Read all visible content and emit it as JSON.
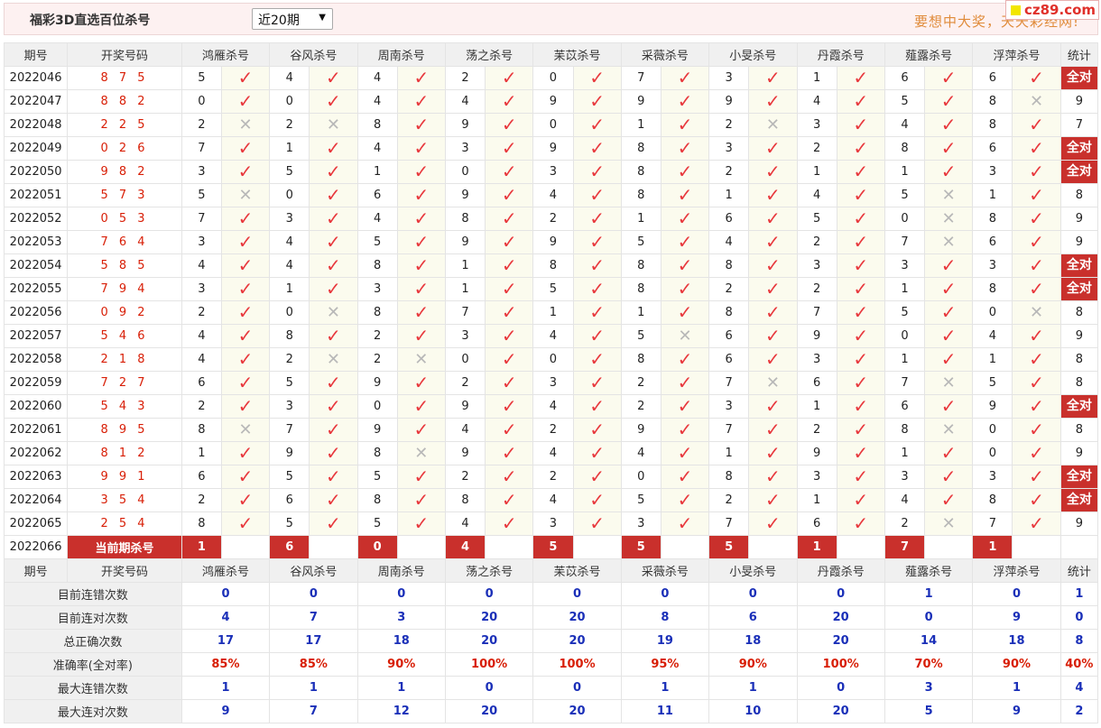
{
  "header": {
    "title": "福彩3D直选百位杀号",
    "period_select": "近20期",
    "slogan": "要想中大奖，天天彩经网!",
    "site_badge": "cz89.com"
  },
  "columns": {
    "issue": "期号",
    "draw": "开奖号码",
    "experts": [
      "鸿雁杀号",
      "谷风杀号",
      "周南杀号",
      "荡之杀号",
      "苿苡杀号",
      "采薇杀号",
      "小旻杀号",
      "丹霞杀号",
      "薤露杀号",
      "浮萍杀号"
    ],
    "stat": "统计"
  },
  "rows": [
    {
      "issue": "2022046",
      "draw": "8 7 5",
      "kills": [
        "5",
        "4",
        "4",
        "2",
        "0",
        "7",
        "3",
        "1",
        "6",
        "6"
      ],
      "marks": "1111111111",
      "stat": "全对"
    },
    {
      "issue": "2022047",
      "draw": "8 8 2",
      "kills": [
        "0",
        "0",
        "4",
        "4",
        "9",
        "9",
        "9",
        "4",
        "5",
        "8"
      ],
      "marks": "1111111110",
      "stat": "9"
    },
    {
      "issue": "2022048",
      "draw": "2 2 5",
      "kills": [
        "2",
        "2",
        "8",
        "9",
        "0",
        "1",
        "2",
        "3",
        "4",
        "8"
      ],
      "marks": "0011110111",
      "stat": "7"
    },
    {
      "issue": "2022049",
      "draw": "0 2 6",
      "kills": [
        "7",
        "1",
        "4",
        "3",
        "9",
        "8",
        "3",
        "2",
        "8",
        "6"
      ],
      "marks": "1111111111",
      "stat": "全对"
    },
    {
      "issue": "2022050",
      "draw": "9 8 2",
      "kills": [
        "3",
        "5",
        "1",
        "0",
        "3",
        "8",
        "2",
        "1",
        "1",
        "3"
      ],
      "marks": "1111111111",
      "stat": "全对"
    },
    {
      "issue": "2022051",
      "draw": "5 7 3",
      "kills": [
        "5",
        "0",
        "6",
        "9",
        "4",
        "8",
        "1",
        "4",
        "5",
        "1"
      ],
      "marks": "0111111101",
      "stat": "8"
    },
    {
      "issue": "2022052",
      "draw": "0 5 3",
      "kills": [
        "7",
        "3",
        "4",
        "8",
        "2",
        "1",
        "6",
        "5",
        "0",
        "8"
      ],
      "marks": "1111111101",
      "stat": "9"
    },
    {
      "issue": "2022053",
      "draw": "7 6 4",
      "kills": [
        "3",
        "4",
        "5",
        "9",
        "9",
        "5",
        "4",
        "2",
        "7",
        "6"
      ],
      "marks": "1111111101",
      "stat": "9"
    },
    {
      "issue": "2022054",
      "draw": "5 8 5",
      "kills": [
        "4",
        "4",
        "8",
        "1",
        "8",
        "8",
        "8",
        "3",
        "3",
        "3"
      ],
      "marks": "1111111111",
      "stat": "全对"
    },
    {
      "issue": "2022055",
      "draw": "7 9 4",
      "kills": [
        "3",
        "1",
        "3",
        "1",
        "5",
        "8",
        "2",
        "2",
        "1",
        "8"
      ],
      "marks": "1111111111",
      "stat": "全对"
    },
    {
      "issue": "2022056",
      "draw": "0 9 2",
      "kills": [
        "2",
        "0",
        "8",
        "7",
        "1",
        "1",
        "8",
        "7",
        "5",
        "0"
      ],
      "marks": "1011111110",
      "stat": "8"
    },
    {
      "issue": "2022057",
      "draw": "5 4 6",
      "kills": [
        "4",
        "8",
        "2",
        "3",
        "4",
        "5",
        "6",
        "9",
        "0",
        "4"
      ],
      "marks": "1111101111",
      "stat": "9"
    },
    {
      "issue": "2022058",
      "draw": "2 1 8",
      "kills": [
        "4",
        "2",
        "2",
        "0",
        "0",
        "8",
        "6",
        "3",
        "1",
        "1"
      ],
      "marks": "1001111111",
      "stat": "8"
    },
    {
      "issue": "2022059",
      "draw": "7 2 7",
      "kills": [
        "6",
        "5",
        "9",
        "2",
        "3",
        "2",
        "7",
        "6",
        "7",
        "5"
      ],
      "marks": "1111110101",
      "stat": "8"
    },
    {
      "issue": "2022060",
      "draw": "5 4 3",
      "kills": [
        "2",
        "3",
        "0",
        "9",
        "4",
        "2",
        "3",
        "1",
        "6",
        "9"
      ],
      "marks": "1111111111",
      "stat": "全对"
    },
    {
      "issue": "2022061",
      "draw": "8 9 5",
      "kills": [
        "8",
        "7",
        "9",
        "4",
        "2",
        "9",
        "7",
        "2",
        "8",
        "0"
      ],
      "marks": "0111111101",
      "stat": "8"
    },
    {
      "issue": "2022062",
      "draw": "8 1 2",
      "kills": [
        "1",
        "9",
        "8",
        "9",
        "4",
        "4",
        "1",
        "9",
        "1",
        "0"
      ],
      "marks": "1101111111",
      "stat": "9"
    },
    {
      "issue": "2022063",
      "draw": "9 9 1",
      "kills": [
        "6",
        "5",
        "5",
        "2",
        "2",
        "0",
        "8",
        "3",
        "3",
        "3"
      ],
      "marks": "1111111111",
      "stat": "全对"
    },
    {
      "issue": "2022064",
      "draw": "3 5 4",
      "kills": [
        "2",
        "6",
        "8",
        "8",
        "4",
        "5",
        "2",
        "1",
        "4",
        "8"
      ],
      "marks": "1111111111",
      "stat": "全对"
    },
    {
      "issue": "2022065",
      "draw": "2 5 4",
      "kills": [
        "8",
        "5",
        "5",
        "4",
        "3",
        "3",
        "7",
        "6",
        "2",
        "7"
      ],
      "marks": "1111111101",
      "stat": "9"
    }
  ],
  "current": {
    "issue": "2022066",
    "label": "当前期杀号",
    "kills": [
      "1",
      "6",
      "0",
      "4",
      "5",
      "5",
      "5",
      "1",
      "7",
      "1"
    ]
  },
  "summary": [
    {
      "label": "目前连错次数",
      "values": [
        "0",
        "0",
        "0",
        "0",
        "0",
        "0",
        "0",
        "0",
        "1",
        "0"
      ],
      "stat": "1"
    },
    {
      "label": "目前连对次数",
      "values": [
        "4",
        "7",
        "3",
        "20",
        "20",
        "8",
        "6",
        "20",
        "0",
        "9"
      ],
      "stat": "0"
    },
    {
      "label": "总正确次数",
      "values": [
        "17",
        "17",
        "18",
        "20",
        "20",
        "19",
        "18",
        "20",
        "14",
        "18"
      ],
      "stat": "8"
    },
    {
      "label": "准确率(全对率)",
      "values": [
        "85%",
        "85%",
        "90%",
        "100%",
        "100%",
        "95%",
        "90%",
        "100%",
        "70%",
        "90%"
      ],
      "stat": "40%",
      "rate": true
    },
    {
      "label": "最大连错次数",
      "values": [
        "1",
        "1",
        "1",
        "0",
        "0",
        "1",
        "1",
        "0",
        "3",
        "1"
      ],
      "stat": "4"
    },
    {
      "label": "最大连对次数",
      "values": [
        "9",
        "7",
        "12",
        "20",
        "20",
        "11",
        "10",
        "20",
        "5",
        "9"
      ],
      "stat": "2"
    }
  ],
  "colors": {
    "accent_red": "#c9302c",
    "draw_red": "#d81e06",
    "check_red": "#e8383d",
    "summary_blue": "#1a2fb8",
    "slogan_orange": "#e08b3a"
  },
  "icons": {
    "ok": "check-icon",
    "no": "cross-icon"
  }
}
